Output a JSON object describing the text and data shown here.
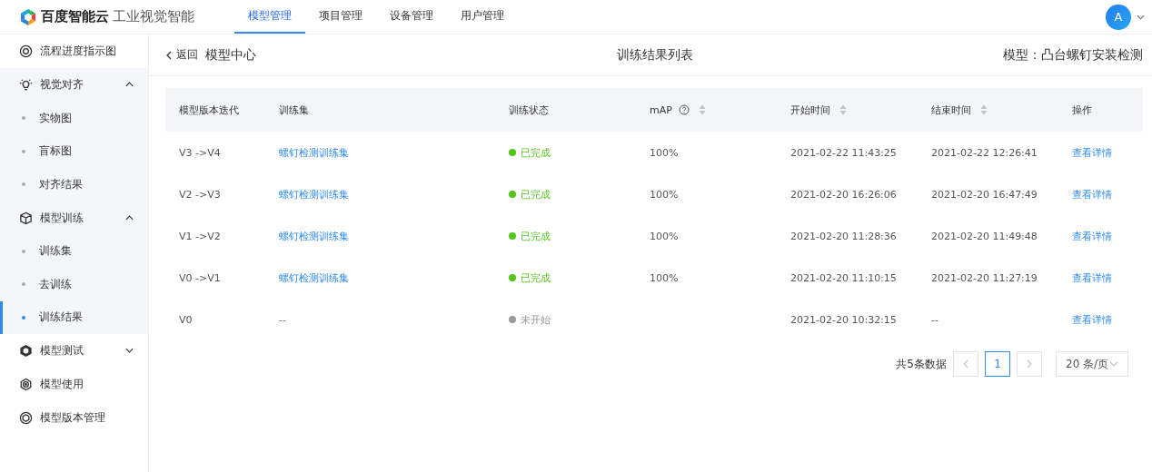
{
  "header": {
    "brand": "百度智能云",
    "product": "工业视觉智能",
    "tabs": [
      {
        "label": "模型管理",
        "selected": true
      },
      {
        "label": "项目管理",
        "selected": false
      },
      {
        "label": "设备管理",
        "selected": false
      },
      {
        "label": "用户管理",
        "selected": false
      }
    ],
    "avatar": "A"
  },
  "sidebar": {
    "items": [
      {
        "label": "流程进度指示图",
        "selected": false
      },
      {
        "label": "视觉对齐",
        "expanded": true,
        "children": [
          {
            "label": "实物图",
            "selected": false
          },
          {
            "label": "盲标图",
            "selected": false
          },
          {
            "label": "对齐结果",
            "selected": false
          }
        ]
      },
      {
        "label": "模型训练",
        "expanded": true,
        "children": [
          {
            "label": "训练集",
            "selected": false
          },
          {
            "label": "去训练",
            "selected": false
          },
          {
            "label": "训练结果",
            "selected": true
          }
        ]
      },
      {
        "label": "模型测试",
        "expanded": false
      },
      {
        "label": "模型使用",
        "selected": false
      },
      {
        "label": "模型版本管理",
        "selected": false
      }
    ]
  },
  "page": {
    "back": "返回",
    "section": "模型中心",
    "title": "训练结果列表",
    "model_label": "模型：",
    "model_name": "凸台螺钉安装检测"
  },
  "table": {
    "columns": [
      {
        "label": "模型版本迭代",
        "help": false,
        "sortable": false
      },
      {
        "label": "训练集",
        "help": false,
        "sortable": false
      },
      {
        "label": "训练状态",
        "help": false,
        "sortable": false
      },
      {
        "label": "mAP",
        "help": true,
        "sortable": true
      },
      {
        "label": "开始时间",
        "help": false,
        "sortable": true
      },
      {
        "label": "结束时间",
        "help": false,
        "sortable": true
      },
      {
        "label": "操作",
        "help": false,
        "sortable": false
      }
    ],
    "rows": [
      {
        "version": "V3 ->V4",
        "dataset": "螺钉检测训练集",
        "status": {
          "label": "已完成",
          "color": "#52c41a"
        },
        "map": "100%",
        "start": "2021-02-22 11:43:25",
        "end": "2021-02-22 12:26:41",
        "action": "查看详情"
      },
      {
        "version": "V2 ->V3",
        "dataset": "螺钉检测训练集",
        "status": {
          "label": "已完成",
          "color": "#52c41a"
        },
        "map": "100%",
        "start": "2021-02-20 16:26:06",
        "end": "2021-02-20 16:47:49",
        "action": "查看详情"
      },
      {
        "version": "V1 ->V2",
        "dataset": "螺钉检测训练集",
        "status": {
          "label": "已完成",
          "color": "#52c41a"
        },
        "map": "100%",
        "start": "2021-02-20 11:28:36",
        "end": "2021-02-20 11:49:48",
        "action": "查看详情"
      },
      {
        "version": "V0 ->V1",
        "dataset": "螺钉检测训练集",
        "status": {
          "label": "已完成",
          "color": "#52c41a"
        },
        "map": "100%",
        "start": "2021-02-20 11:10:15",
        "end": "2021-02-20 11:27:19",
        "action": "查看详情"
      },
      {
        "version": "V0",
        "dataset": "--",
        "status": {
          "label": "未开始",
          "color": "#999999"
        },
        "start": "2021-02-20 10:32:15",
        "end": "--",
        "action": "查看详情"
      }
    ]
  },
  "pagination": {
    "total": "共5条数据",
    "pages": [
      {
        "label": "1",
        "selected": true
      }
    ],
    "page_size": "20 条/页"
  }
}
